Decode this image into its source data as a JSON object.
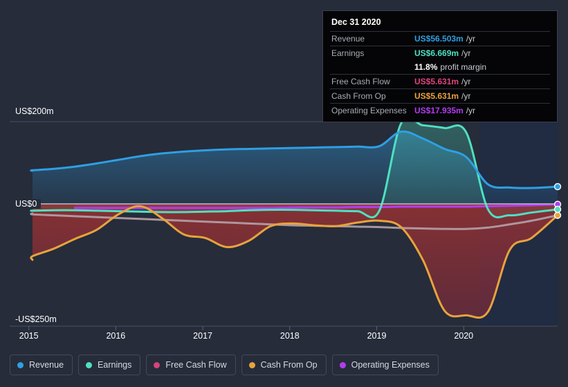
{
  "axes": {
    "y_top_label": "US$200m",
    "y_zero_label": "US$0",
    "y_bottom_label": "-US$250m",
    "x_labels": [
      "2015",
      "2016",
      "2017",
      "2018",
      "2019",
      "2020"
    ]
  },
  "tooltip": {
    "title": "Dec 31 2020",
    "rows": [
      {
        "key": "Revenue",
        "value": "US$56.503m",
        "unit": "/yr",
        "color": "#2f9fe3"
      },
      {
        "key": "Earnings",
        "value": "US$6.669m",
        "unit": "/yr",
        "color": "#4fe0c0"
      },
      {
        "key": "",
        "value": "11.8%",
        "unit": "profit margin",
        "color": "#ffffff"
      },
      {
        "key": "Free Cash Flow",
        "value": "US$5.631m",
        "unit": "/yr",
        "color": "#e0447d"
      },
      {
        "key": "Cash From Op",
        "value": "US$5.631m",
        "unit": "/yr",
        "color": "#e8a33d"
      },
      {
        "key": "Operating Expenses",
        "value": "US$17.935m",
        "unit": "/yr",
        "color": "#b23df0"
      }
    ]
  },
  "legend": [
    {
      "label": "Revenue",
      "color": "#2f9fe3"
    },
    {
      "label": "Earnings",
      "color": "#4fe0c0"
    },
    {
      "label": "Free Cash Flow",
      "color": "#d4437c"
    },
    {
      "label": "Cash From Op",
      "color": "#e8a33d"
    },
    {
      "label": "Operating Expenses",
      "color": "#b23df0"
    }
  ],
  "chart_data": {
    "type": "area",
    "title": "",
    "xlabel": "",
    "ylabel": "",
    "ylim": [
      -250,
      200
    ],
    "y_unit": "US$m",
    "grid": true,
    "legend_position": "bottom",
    "x": [
      2014.6,
      2014.85,
      2015.1,
      2015.35,
      2015.6,
      2015.85,
      2016.1,
      2016.35,
      2016.6,
      2016.85,
      2017.1,
      2017.35,
      2017.6,
      2017.85,
      2018.1,
      2018.35,
      2018.6,
      2018.85,
      2019.1,
      2019.35,
      2019.6,
      2019.85,
      2020.1,
      2020.35,
      2020.6,
      2020.9
    ],
    "x_axis_range": [
      2014.6,
      2020.9
    ],
    "forecast_start": 2020.0,
    "series": [
      {
        "name": "Revenue",
        "color": "#2f9fe3",
        "values": [
          92,
          93,
          96,
          101,
          108,
          116,
          124,
          130,
          134,
          137,
          139,
          140,
          141,
          142,
          143,
          144,
          145,
          146,
          178,
          163,
          140,
          122,
          62,
          55,
          54,
          57
        ]
      },
      {
        "name": "Earnings",
        "color": "#4fe0c0",
        "values": [
          4,
          4,
          5,
          5,
          4,
          3,
          2,
          1,
          1,
          2,
          3,
          5,
          6,
          6,
          5,
          4,
          3,
          4,
          196,
          192,
          186,
          176,
          7,
          -6,
          0,
          7
        ]
      },
      {
        "name": "Free Cash Flow",
        "color": "#d4437c",
        "values": [
          -2,
          -4,
          -6,
          -8,
          -10,
          -12,
          -14,
          -16,
          -18,
          -20,
          -22,
          -24,
          -26,
          -28,
          -29,
          -30,
          -31,
          -32,
          -34,
          -35,
          -36,
          -36,
          -33,
          -26,
          -18,
          -6
        ]
      },
      {
        "name": "Cash From Op",
        "color": "#e8a33d",
        "values": [
          -104,
          -96,
          -80,
          -58,
          -38,
          -4,
          14,
          -12,
          -48,
          -56,
          -76,
          -62,
          -30,
          -24,
          -28,
          -30,
          -22,
          -18,
          -32,
          -104,
          -216,
          -226,
          -218,
          -82,
          -56,
          -6
        ]
      },
      {
        "name": "Operating Expenses",
        "color": "#b23df0",
        "values": [
          null,
          null,
          null,
          10,
          10,
          10,
          10,
          10,
          10,
          10,
          10,
          10,
          10,
          11,
          11,
          11,
          12,
          12,
          13,
          13,
          13,
          13,
          14,
          15,
          16,
          18
        ]
      }
    ]
  }
}
